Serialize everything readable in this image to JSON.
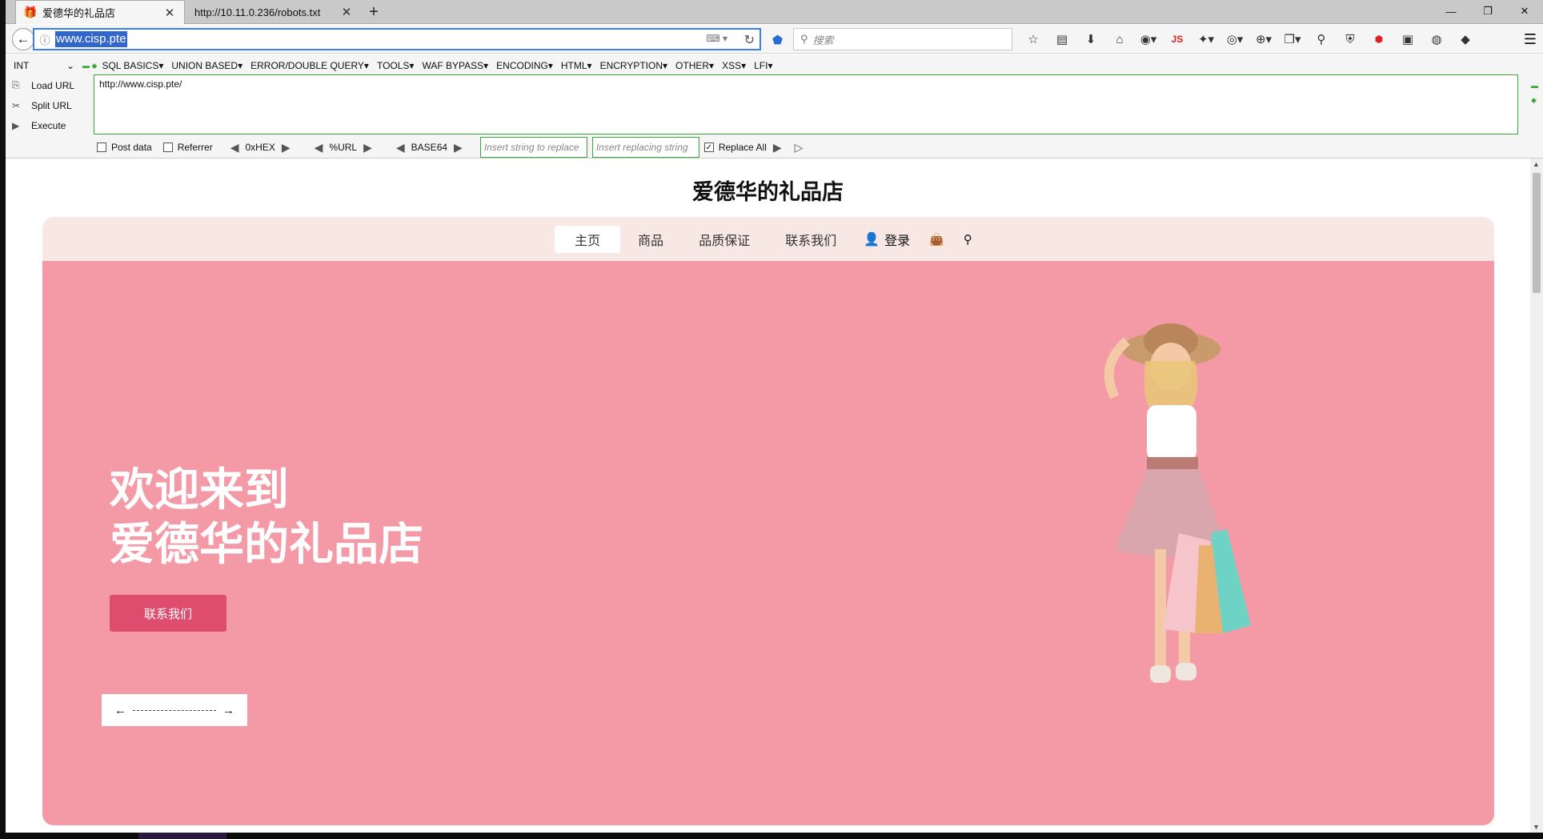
{
  "tabs": [
    {
      "title": "爱德华的礼品店",
      "active": true
    },
    {
      "title": "http://10.11.0.236/robots.txt",
      "active": false
    }
  ],
  "window_controls": [
    "—",
    "❐",
    "✕"
  ],
  "navbar": {
    "url": "www.cisp.pte",
    "search_placeholder": "搜索"
  },
  "hackbar": {
    "select": "INT",
    "menus": [
      "SQL BASICS▾",
      "UNION BASED▾",
      "ERROR/DOUBLE QUERY▾",
      "TOOLS▾",
      "WAF BYPASS▾",
      "ENCODING▾",
      "HTML▾",
      "ENCRYPTION▾",
      "OTHER▾",
      "XSS▾",
      "LFI▾"
    ],
    "actions": {
      "load": "Load URL",
      "split": "Split URL",
      "execute": "Execute"
    },
    "text": "http://www.cisp.pte/",
    "post_data": "Post data",
    "referrer": "Referrer",
    "hex": "0xHEX",
    "urlenc": "%URL",
    "base64": "BASE64",
    "replace_ph": "Insert string to replace",
    "replacing_ph": "Insert replacing string",
    "replace_all": "Replace All"
  },
  "site": {
    "title": "爱德华的礼品店",
    "nav": [
      "主页",
      "商品",
      "品质保证",
      "联系我们"
    ],
    "login": "登录",
    "hero_line1": "欢迎来到",
    "hero_line2": "爱德华的礼品店",
    "hero_button": "联系我们"
  },
  "colors": {
    "hero_bg": "#f49aa7",
    "nav_bg": "#f8e8e4",
    "button": "#df4d6e",
    "url_highlight": "#3366cc",
    "hackbar_border": "#3aa83a"
  }
}
